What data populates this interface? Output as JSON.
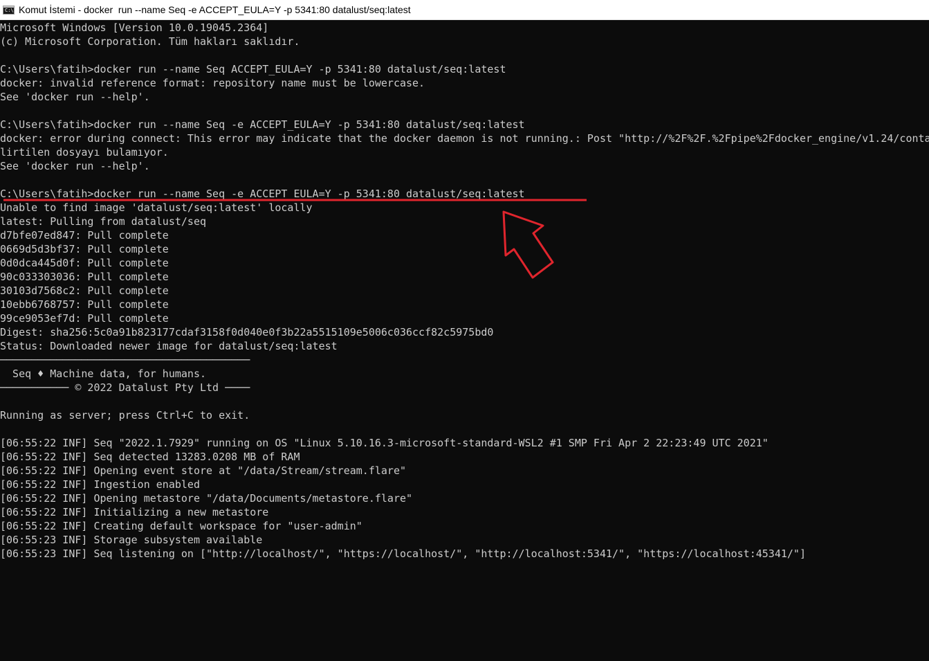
{
  "window": {
    "title": "Komut İstemi - docker  run --name Seq -e ACCEPT_EULA=Y -p 5341:80 datalust/seq:latest",
    "icon": "cmd-console-icon",
    "icon_text": "C:\\."
  },
  "console": {
    "lines": [
      "Microsoft Windows [Version 10.0.19045.2364]",
      "(c) Microsoft Corporation. Tüm hakları saklıdır.",
      "",
      "C:\\Users\\fatih>docker run --name Seq ACCEPT_EULA=Y -p 5341:80 datalust/seq:latest",
      "docker: invalid reference format: repository name must be lowercase.",
      "See 'docker run --help'.",
      "",
      "C:\\Users\\fatih>docker run --name Seq -e ACCEPT_EULA=Y -p 5341:80 datalust/seq:latest",
      "docker: error during connect: This error may indicate that the docker daemon is not running.: Post \"http://%2F%2F.%2Fpipe%2Fdocker_engine/v1.24/conta",
      "lirtilen dosyayı bulamıyor.",
      "See 'docker run --help'.",
      "",
      "C:\\Users\\fatih>docker run --name Seq -e ACCEPT_EULA=Y -p 5341:80 datalust/seq:latest",
      "Unable to find image 'datalust/seq:latest' locally",
      "latest: Pulling from datalust/seq",
      "d7bfe07ed847: Pull complete",
      "0669d5d3bf37: Pull complete",
      "0d0dca445d0f: Pull complete",
      "90c033303036: Pull complete",
      "30103d7568c2: Pull complete",
      "10ebb6768757: Pull complete",
      "99ce9053ef7d: Pull complete",
      "Digest: sha256:5c0a91b823177cdaf3158f0d040e0f3b22a5515109e5006c036ccf82c5975bd0",
      "Status: Downloaded newer image for datalust/seq:latest",
      "────────────────────────────────────────",
      "  Seq ♦ Machine data, for humans.",
      "─────────── © 2022 Datalust Pty Ltd ────",
      "",
      "Running as server; press Ctrl+C to exit.",
      "",
      "[06:55:22 INF] Seq \"2022.1.7929\" running on OS \"Linux 5.10.16.3-microsoft-standard-WSL2 #1 SMP Fri Apr 2 22:23:49 UTC 2021\"",
      "[06:55:22 INF] Seq detected 13283.0208 MB of RAM",
      "[06:55:22 INF] Opening event store at \"/data/Stream/stream.flare\"",
      "[06:55:22 INF] Ingestion enabled",
      "[06:55:22 INF] Opening metastore \"/data/Documents/metastore.flare\"",
      "[06:55:22 INF] Initializing a new metastore",
      "[06:55:22 INF] Creating default workspace for \"user-admin\"",
      "[06:55:23 INF] Storage subsystem available",
      "[06:55:23 INF] Seq listening on [\"http://localhost/\", \"https://localhost/\", \"http://localhost:5341/\", \"https://localhost:45341/\"]"
    ]
  },
  "colors": {
    "console_background": "#0c0c0c",
    "console_text": "#cccccc",
    "annotation_red": "#e0252d",
    "titlebar_background": "#ffffff"
  },
  "annotation": {
    "underline": "red-underline",
    "arrow": "red-arrow-pointing-up-left"
  }
}
